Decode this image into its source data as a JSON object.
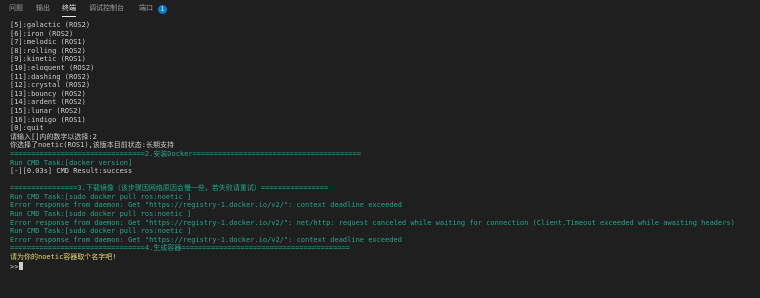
{
  "tabs": {
    "problems": "问题",
    "output": "输出",
    "terminal": "终端",
    "debug_console": "调试控制台",
    "ports": "端口",
    "ports_badge": "1"
  },
  "colors": {
    "background": "#1f1f1f",
    "text": "#cccccc",
    "green": "#23a68a",
    "yellow": "#dcdc70",
    "badge": "#0e7ad3"
  },
  "terminal": {
    "lines": [
      {
        "text": "[5]:galactic (ROS2)",
        "color": "w"
      },
      {
        "text": "[6]:iron (ROS2)",
        "color": "w"
      },
      {
        "text": "[7]:melodic (ROS1)",
        "color": "w"
      },
      {
        "text": "[8]:rolling (ROS2)",
        "color": "w"
      },
      {
        "text": "[9]:kinetic (ROS1)",
        "color": "w"
      },
      {
        "text": "[10]:eloquent (ROS2)",
        "color": "w"
      },
      {
        "text": "[11]:dashing (ROS2)",
        "color": "w"
      },
      {
        "text": "[12]:crystal (ROS2)",
        "color": "w"
      },
      {
        "text": "[13]:bouncy (ROS2)",
        "color": "w"
      },
      {
        "text": "[14]:ardent (ROS2)",
        "color": "w"
      },
      {
        "text": "[15]:lunar (ROS2)",
        "color": "w"
      },
      {
        "text": "[16]:indigo (ROS1)",
        "color": "w"
      },
      {
        "text": "[0]:quit",
        "color": "w"
      },
      {
        "text": "请输入[]内的数字以选择:2",
        "color": "w"
      },
      {
        "text": "你选择了noetic(ROS1),该版本目前状态:长期支持",
        "color": "w"
      },
      {
        "text": "================================2.安装Docker========================================",
        "color": "g"
      },
      {
        "text": "Run CMD Task:[docker version]",
        "color": "g"
      },
      {
        "text": "[-][0.03s] CMD Result:success",
        "color": "w"
      },
      {
        "text": "",
        "color": "w"
      },
      {
        "text": "================3.下载镜像（该步骤因网络原因会慢一些，若失败请重试）================",
        "color": "g"
      },
      {
        "text": "Run CMD Task:[sudo docker pull ros:noetic ]",
        "color": "g"
      },
      {
        "text": "Error response from daemon: Get \"https://registry-1.docker.io/v2/\": context deadline exceeded",
        "color": "g"
      },
      {
        "text": "Run CMD Task:[sudo docker pull ros:noetic ]",
        "color": "g"
      },
      {
        "text": "Error response from daemon: Get \"https://registry-1.docker.io/v2/\": net/http: request canceled while waiting for connection (Client.Timeout exceeded while awaiting headers)",
        "color": "g"
      },
      {
        "text": "Run CMD Task:[sudo docker pull ros:noetic ]",
        "color": "g"
      },
      {
        "text": "Error response from daemon: Get \"https://registry-1.docker.io/v2/\": context deadline exceeded",
        "color": "g"
      },
      {
        "text": "================================4.生成容器========================================",
        "color": "g"
      },
      {
        "text": "请为你的noetic容器取个名字吧!",
        "color": "y"
      },
      {
        "text": ">>",
        "color": "w"
      }
    ]
  }
}
